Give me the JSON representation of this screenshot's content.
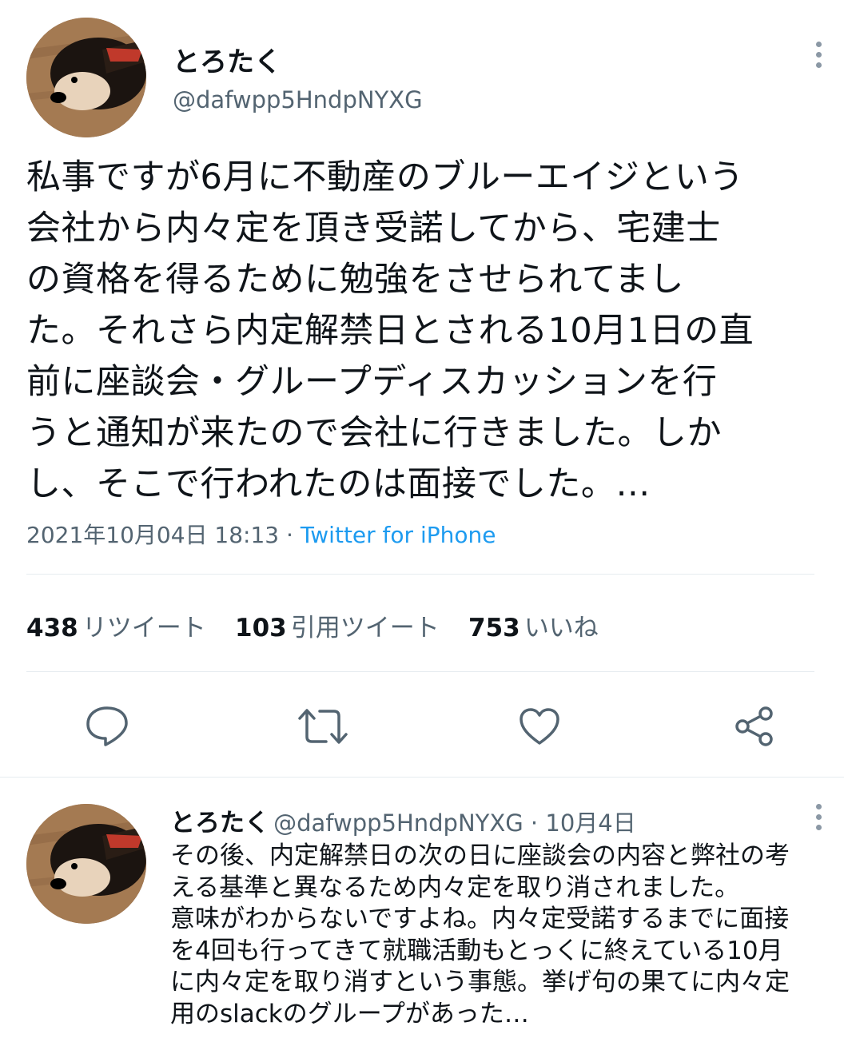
{
  "tweet": {
    "name": "とろたく",
    "handle": "@dafwpp5HndpNYXG",
    "text": "私事ですが6月に不動産のブルーエイジという\n会社から内々定を頂き受諾してから、宅建士\nの資格を得るために勉強をさせられてまし\nた。それさら内定解禁日とされる10月1日の直\n前に座談会・グループディスカッションを行\nうと通知が来たので会社に行きました。しか\nし、そこで行われたのは面接でした。…",
    "timestamp": "2021年10月04日 18:13",
    "separator": " · ",
    "source": "Twitter for iPhone",
    "stats": {
      "retweets_count": "438",
      "retweets_label": "リツイート",
      "quotes_count": "103",
      "quotes_label": "引用ツイート",
      "likes_count": "753",
      "likes_label": "いいね"
    },
    "actions": {
      "reply_icon": "speech-bubble-icon",
      "retweet_icon": "retweet-arrows-icon",
      "like_icon": "heart-icon",
      "share_icon": "share-icon"
    }
  },
  "reply": {
    "name": "とろたく",
    "handle": "@dafwpp5HndpNYXG",
    "separator": " · ",
    "date": "10月4日",
    "text": "その後、内定解禁日の次の日に座談会の内容と弊社の考\nえる基準と異なるため内々定を取り消されました。\n意味がわからないですよね。内々定受諾するまでに面接\nを4回も行ってきて就職活動もとっくに終えている10月\nに内々定を取り消すという事態。挙げ句の果てに内々定\n用のslackのグループがあった…"
  },
  "colors": {
    "text": "#0f1419",
    "secondary": "#536471",
    "link": "#1d9bf0",
    "divider": "#e6ecf0"
  }
}
